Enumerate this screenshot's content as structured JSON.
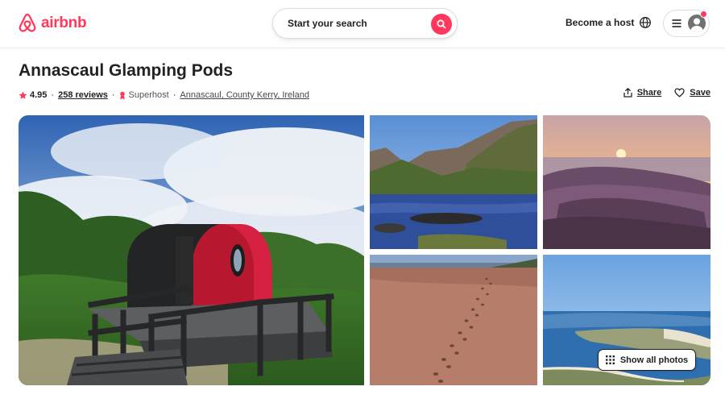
{
  "header": {
    "logo_text": "airbnb",
    "search_placeholder": "Start your search",
    "become_host": "Become a host"
  },
  "listing": {
    "title": "Annascaul Glamping Pods",
    "rating": "4.95",
    "reviews": "258 reviews",
    "host_badge": "Superhost",
    "location": "Annascaul, County Kerry, Ireland"
  },
  "actions": {
    "share": "Share",
    "save": "Save"
  },
  "gallery": {
    "show_all": "Show all photos"
  },
  "colors": {
    "brand": "#FF385C",
    "text": "#222222"
  },
  "icons": [
    "airbnb-logo-icon",
    "search-icon",
    "globe-icon",
    "menu-icon",
    "avatar-icon",
    "star-icon",
    "superhost-icon",
    "share-icon",
    "heart-icon",
    "grid-icon"
  ]
}
